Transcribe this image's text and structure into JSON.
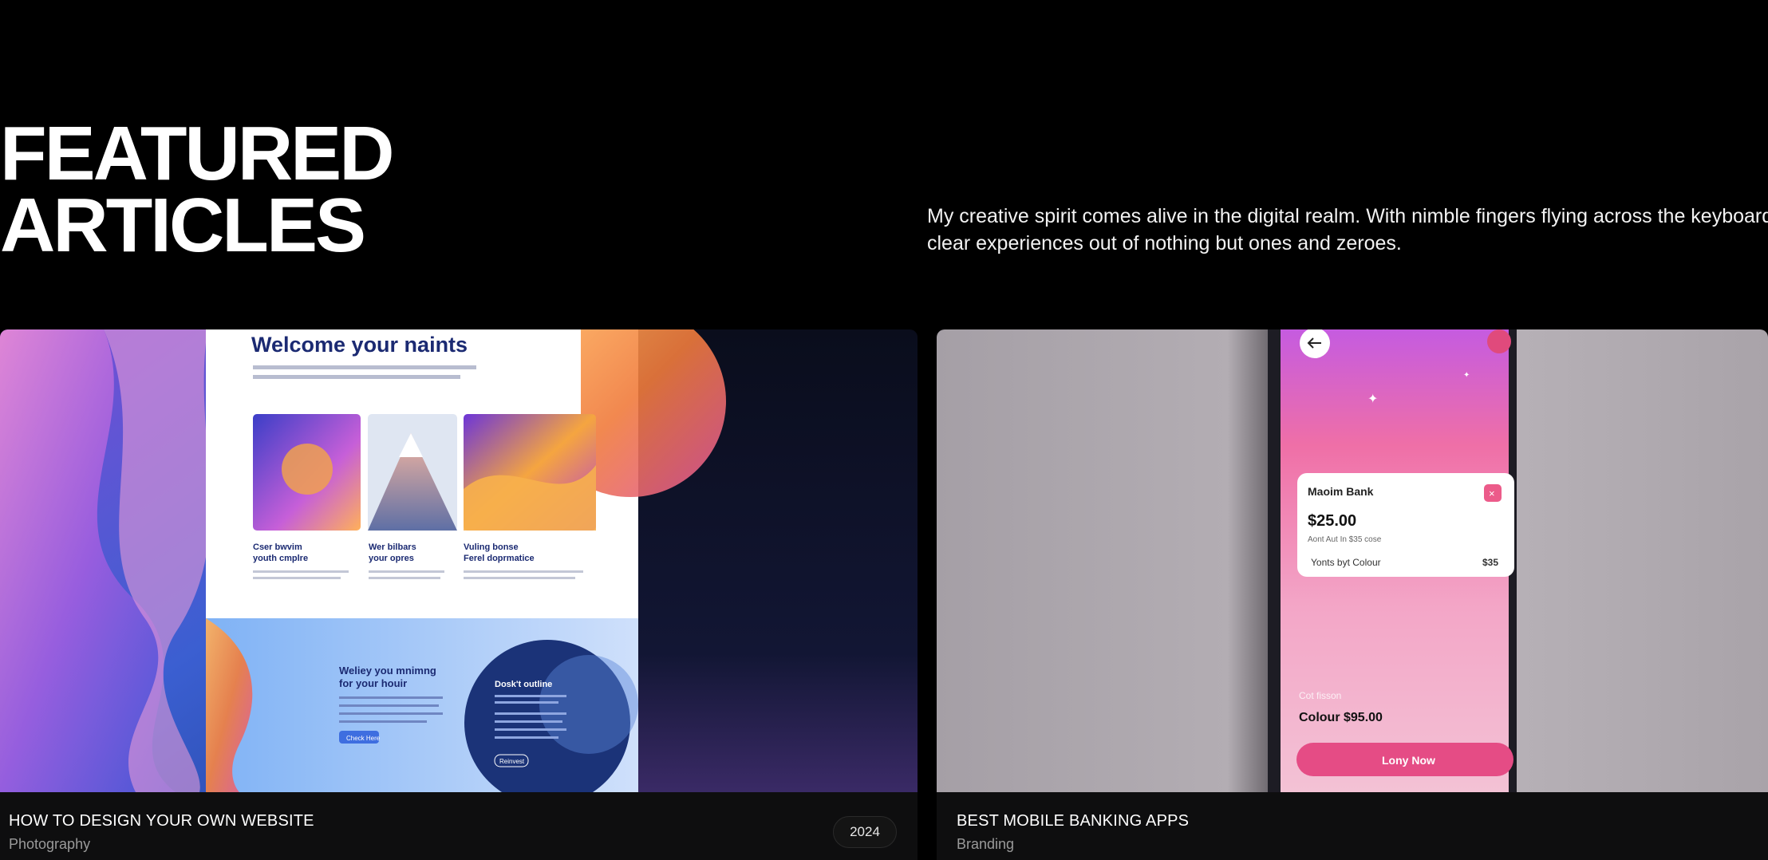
{
  "hero": {
    "title_line1": "FEATURED",
    "title_line2": "ARTICLES"
  },
  "intro": {
    "line1": "My creative spirit comes alive in the digital realm. With nimble fingers flying across the keyboard, I craft",
    "line2": "clear experiences out of nothing but ones and zeroes."
  },
  "articles": [
    {
      "title": "HOW TO DESIGN YOUR OWN WEBSITE",
      "category": "Photography",
      "year": "2024",
      "mockup": {
        "heading": "Welcome your naints",
        "col1": "Cser bwvim\nyouth cmplre",
        "col2": "Wer bilbars\nyour opres",
        "col3": "Vuling bonse\nFerel doprmatice",
        "section_heading": "Weliey you mnimng\nfor your houir",
        "circle_heading": "Dosk't outline",
        "button": "Check Here",
        "circle_button": "Reinvest"
      }
    },
    {
      "title": "BEST MOBILE BANKING APPS",
      "category": "Branding",
      "mockup": {
        "bank_name": "Maoim Bank",
        "amount": "$25.00",
        "amount_sub": "Aont Aut In $35 cose",
        "row_label": "Yonts byt Colour",
        "row_value": "$35",
        "caption": "Cot fisson",
        "price": "Colour $95.00",
        "cta": "Lony Now"
      }
    }
  ]
}
